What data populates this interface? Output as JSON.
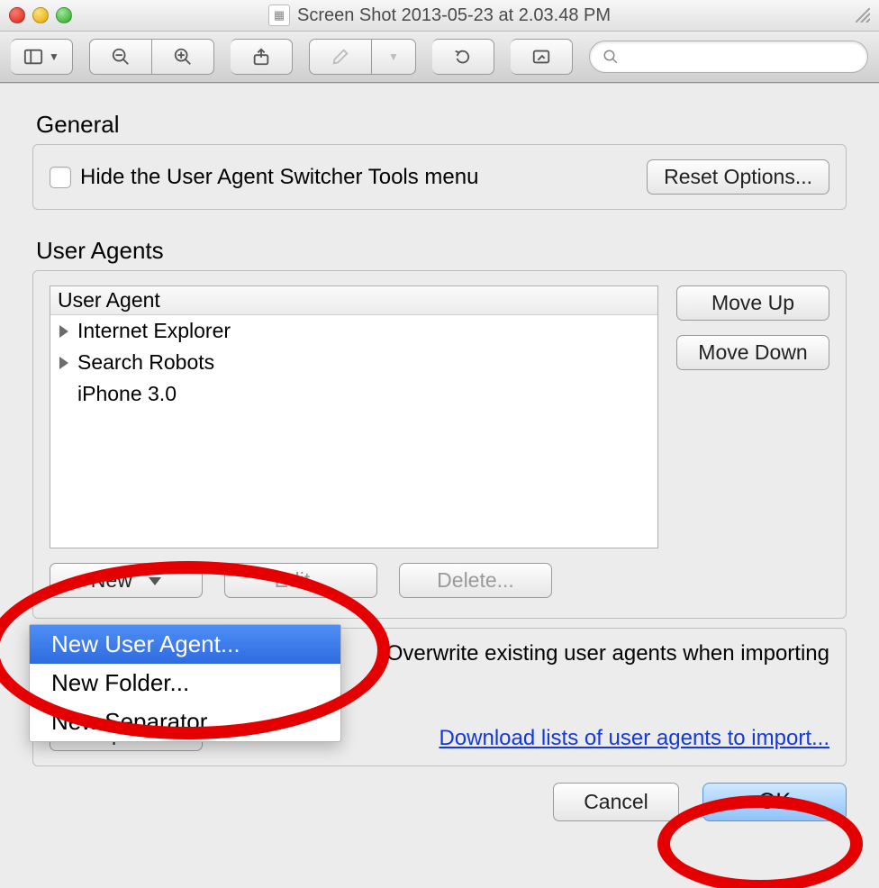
{
  "window": {
    "title": "Screen Shot 2013-05-23 at 2.03.48 PM"
  },
  "search": {
    "placeholder": ""
  },
  "sections": {
    "general_title": "General",
    "user_agents_title": "User Agents"
  },
  "general": {
    "hide_tools_label": "Hide the User Agent Switcher Tools menu",
    "reset_options_label": "Reset Options..."
  },
  "user_agents": {
    "column_header": "User Agent",
    "items": [
      {
        "label": "Internet Explorer",
        "expandable": true
      },
      {
        "label": "Search Robots",
        "expandable": true
      },
      {
        "label": "iPhone 3.0",
        "expandable": false
      }
    ],
    "move_up_label": "Move Up",
    "move_down_label": "Move Down",
    "new_label": "New",
    "edit_label": "Edit...",
    "delete_label": "Delete..."
  },
  "new_menu": {
    "items": [
      "New User Agent...",
      "New Folder...",
      "New Separator"
    ],
    "selected_index": 0
  },
  "import_export": {
    "overwrite_label": "Overwrite existing user agents when importing",
    "export_label": "Export...",
    "download_link_label": "Download lists of user agents to import..."
  },
  "footer": {
    "cancel_label": "Cancel",
    "ok_label": "OK"
  }
}
